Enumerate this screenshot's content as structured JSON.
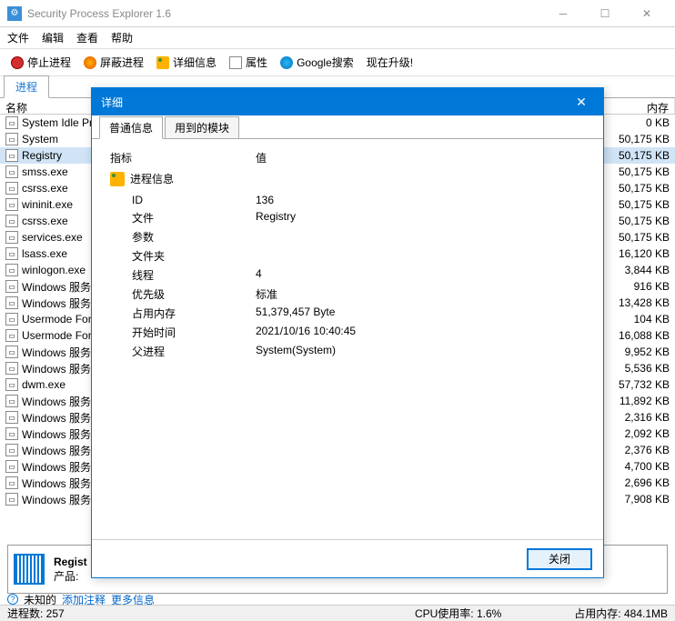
{
  "app": {
    "title": "Security Process Explorer 1.6"
  },
  "menu": [
    "文件",
    "编辑",
    "查看",
    "帮助"
  ],
  "toolbar": {
    "stop": "停止进程",
    "block": "屏蔽进程",
    "info": "详细信息",
    "prop": "属性",
    "google": "Google搜索",
    "upgrade": "现在升级!"
  },
  "tabs": {
    "process": "进程"
  },
  "columns": {
    "name": "名称",
    "mem": "内存"
  },
  "rows": [
    {
      "name": "System Idle Pr",
      "mem": "0 KB"
    },
    {
      "name": "System",
      "mem": "50,175 KB"
    },
    {
      "name": "Registry",
      "mem": "50,175 KB",
      "selected": true
    },
    {
      "name": "smss.exe",
      "mem": "50,175 KB"
    },
    {
      "name": "csrss.exe",
      "mem": "50,175 KB"
    },
    {
      "name": "wininit.exe",
      "mem": "50,175 KB"
    },
    {
      "name": "csrss.exe",
      "mem": "50,175 KB"
    },
    {
      "name": "services.exe",
      "mem": "50,175 KB"
    },
    {
      "name": "lsass.exe",
      "mem": "16,120 KB"
    },
    {
      "name": "winlogon.exe",
      "mem": "3,844 KB"
    },
    {
      "name": "Windows 服务",
      "mem": "916 KB"
    },
    {
      "name": "Windows 服务",
      "mem": "13,428 KB"
    },
    {
      "name": "Usermode Fon",
      "mem": "104 KB"
    },
    {
      "name": "Usermode Fon",
      "mem": "16,088 KB"
    },
    {
      "name": "Windows 服务",
      "mem": "9,952 KB"
    },
    {
      "name": "Windows 服务",
      "mem": "5,536 KB"
    },
    {
      "name": "dwm.exe",
      "mem": "57,732 KB"
    },
    {
      "name": "Windows 服务",
      "mem": "11,892 KB"
    },
    {
      "name": "Windows 服务",
      "mem": "2,316 KB"
    },
    {
      "name": "Windows 服务",
      "mem": "2,092 KB"
    },
    {
      "name": "Windows 服务",
      "mem": "2,376 KB"
    },
    {
      "name": "Windows 服务",
      "mem": "4,700 KB"
    },
    {
      "name": "Windows 服务",
      "mem": "2,696 KB"
    },
    {
      "name": "Windows 服务",
      "mem": "7,908 KB"
    }
  ],
  "detail_panel": {
    "title": "Regist",
    "label": "产品:"
  },
  "links": {
    "unknown": "未知的",
    "add": "添加注释",
    "more": "更多信息"
  },
  "status": {
    "count": "进程数: 257",
    "cpu": "CPU使用率: 1.6%",
    "mem": "占用内存: 484.1MB"
  },
  "dialog": {
    "title": "详细",
    "tabs": {
      "general": "普通信息",
      "modules": "用到的模块"
    },
    "header": {
      "key": "指标",
      "value": "值"
    },
    "section": "进程信息",
    "rows": [
      {
        "k": "ID",
        "v": "136"
      },
      {
        "k": "文件",
        "v": "Registry"
      },
      {
        "k": "参数",
        "v": ""
      },
      {
        "k": "文件夹",
        "v": ""
      },
      {
        "k": "线程",
        "v": "4"
      },
      {
        "k": "优先级",
        "v": "标准"
      },
      {
        "k": "占用内存",
        "v": "51,379,457 Byte"
      },
      {
        "k": "开始时间",
        "v": "2021/10/16 10:40:45"
      },
      {
        "k": "父进程",
        "v": "System(System)"
      }
    ],
    "close": "关闭"
  }
}
